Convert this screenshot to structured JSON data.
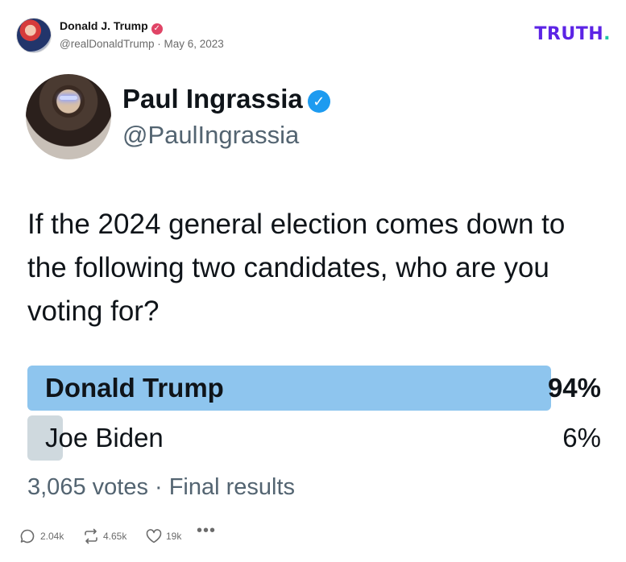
{
  "header": {
    "author_name": "Donald J. Trump",
    "author_meta": "@realDonaldTrump · May 6, 2023",
    "brand_main": "TRUTH",
    "brand_dot": "."
  },
  "embedded_post": {
    "name": "Paul Ingrassia",
    "handle": "@PaulIngrassia",
    "question": "If the 2024 general election comes down to the following two candidates, who are you voting for?",
    "poll": {
      "options": [
        {
          "label": "Donald Trump",
          "percent_text": "94%",
          "percent": 94,
          "color": "#8ec5ee"
        },
        {
          "label": "Joe Biden",
          "percent_text": "6%",
          "percent": 6,
          "color": "#cfd9de"
        }
      ],
      "footer": "3,065 votes · Final results"
    }
  },
  "actions": {
    "replies": "2.04k",
    "retruths": "4.65k",
    "likes": "19k",
    "more": "•••"
  },
  "icons": [
    "verified-badge-icon",
    "comment-icon",
    "retruth-icon",
    "heart-icon",
    "more-icon"
  ],
  "colors": {
    "brand": "#5c24e5",
    "brand_dot": "#1fc7a5",
    "verified_small": "#e04466",
    "verified_big": "#1d9bf0"
  }
}
